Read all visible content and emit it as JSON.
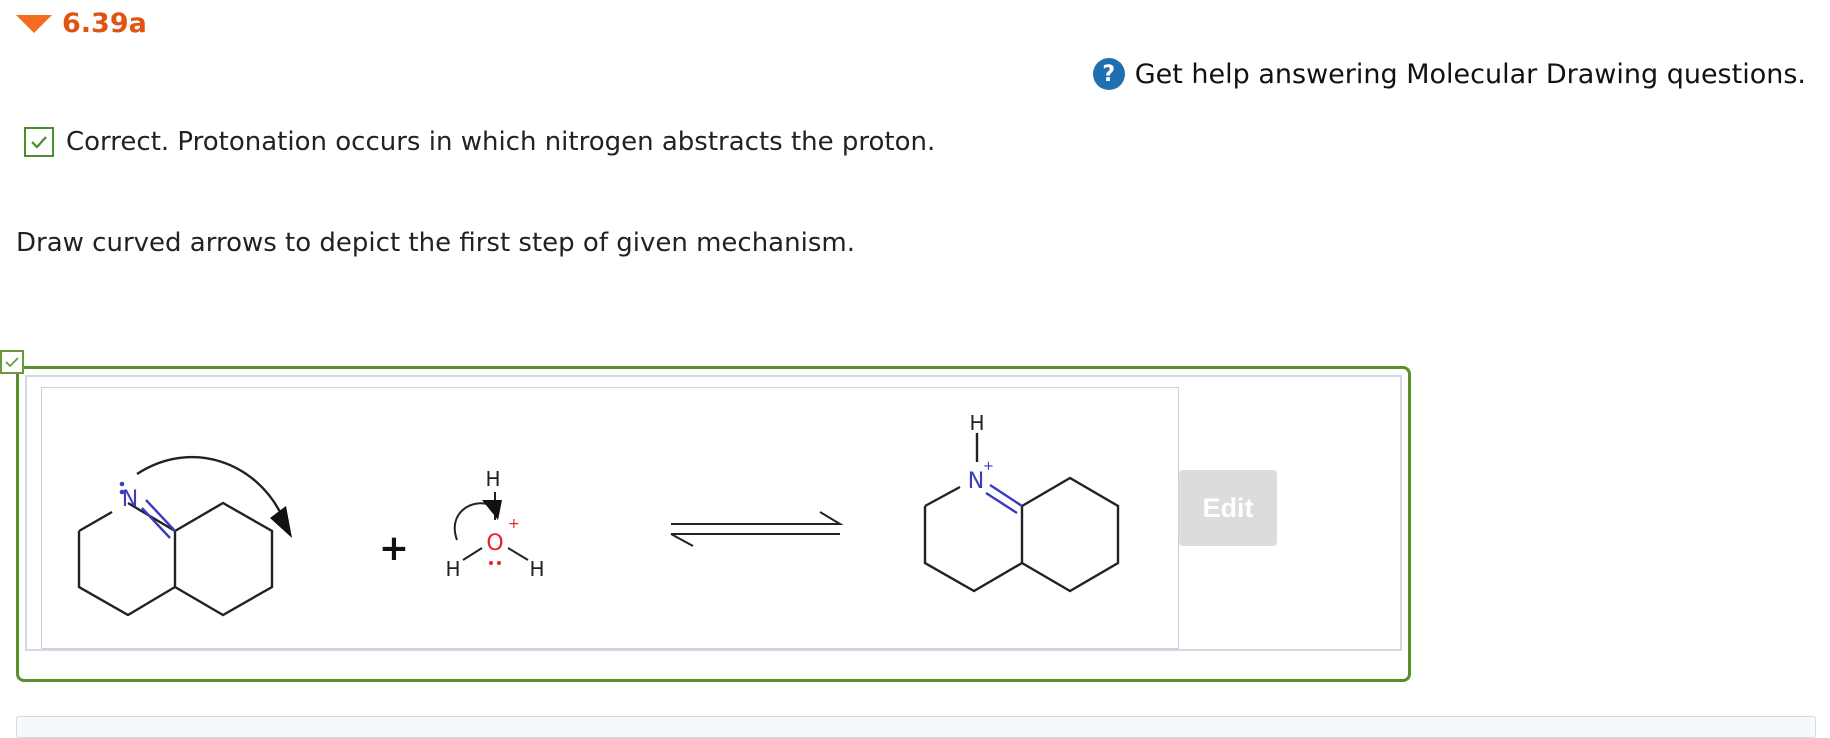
{
  "question": {
    "title": "6.39a"
  },
  "help": {
    "icon": "?",
    "text": "Get help answering Molecular Drawing questions."
  },
  "feedback": {
    "status": "correct",
    "text": "Correct. Protonation occurs in which nitrogen abstracts the proton."
  },
  "prompt": {
    "text": "Draw curved arrows to depict the first step of given mechanism."
  },
  "drawing": {
    "reactant1": {
      "atom_label": "N"
    },
    "plus": "+",
    "reactant2": {
      "atoms": [
        "H",
        "O",
        "H",
        "H"
      ],
      "charge": "+"
    },
    "product": {
      "atoms": [
        "H",
        "N"
      ],
      "charge": "+"
    },
    "colors": {
      "nitrogen": "#3b3bbf",
      "oxygen": "#e8202a",
      "bond": "#222222"
    }
  },
  "edit_button": {
    "label": "Edit"
  }
}
